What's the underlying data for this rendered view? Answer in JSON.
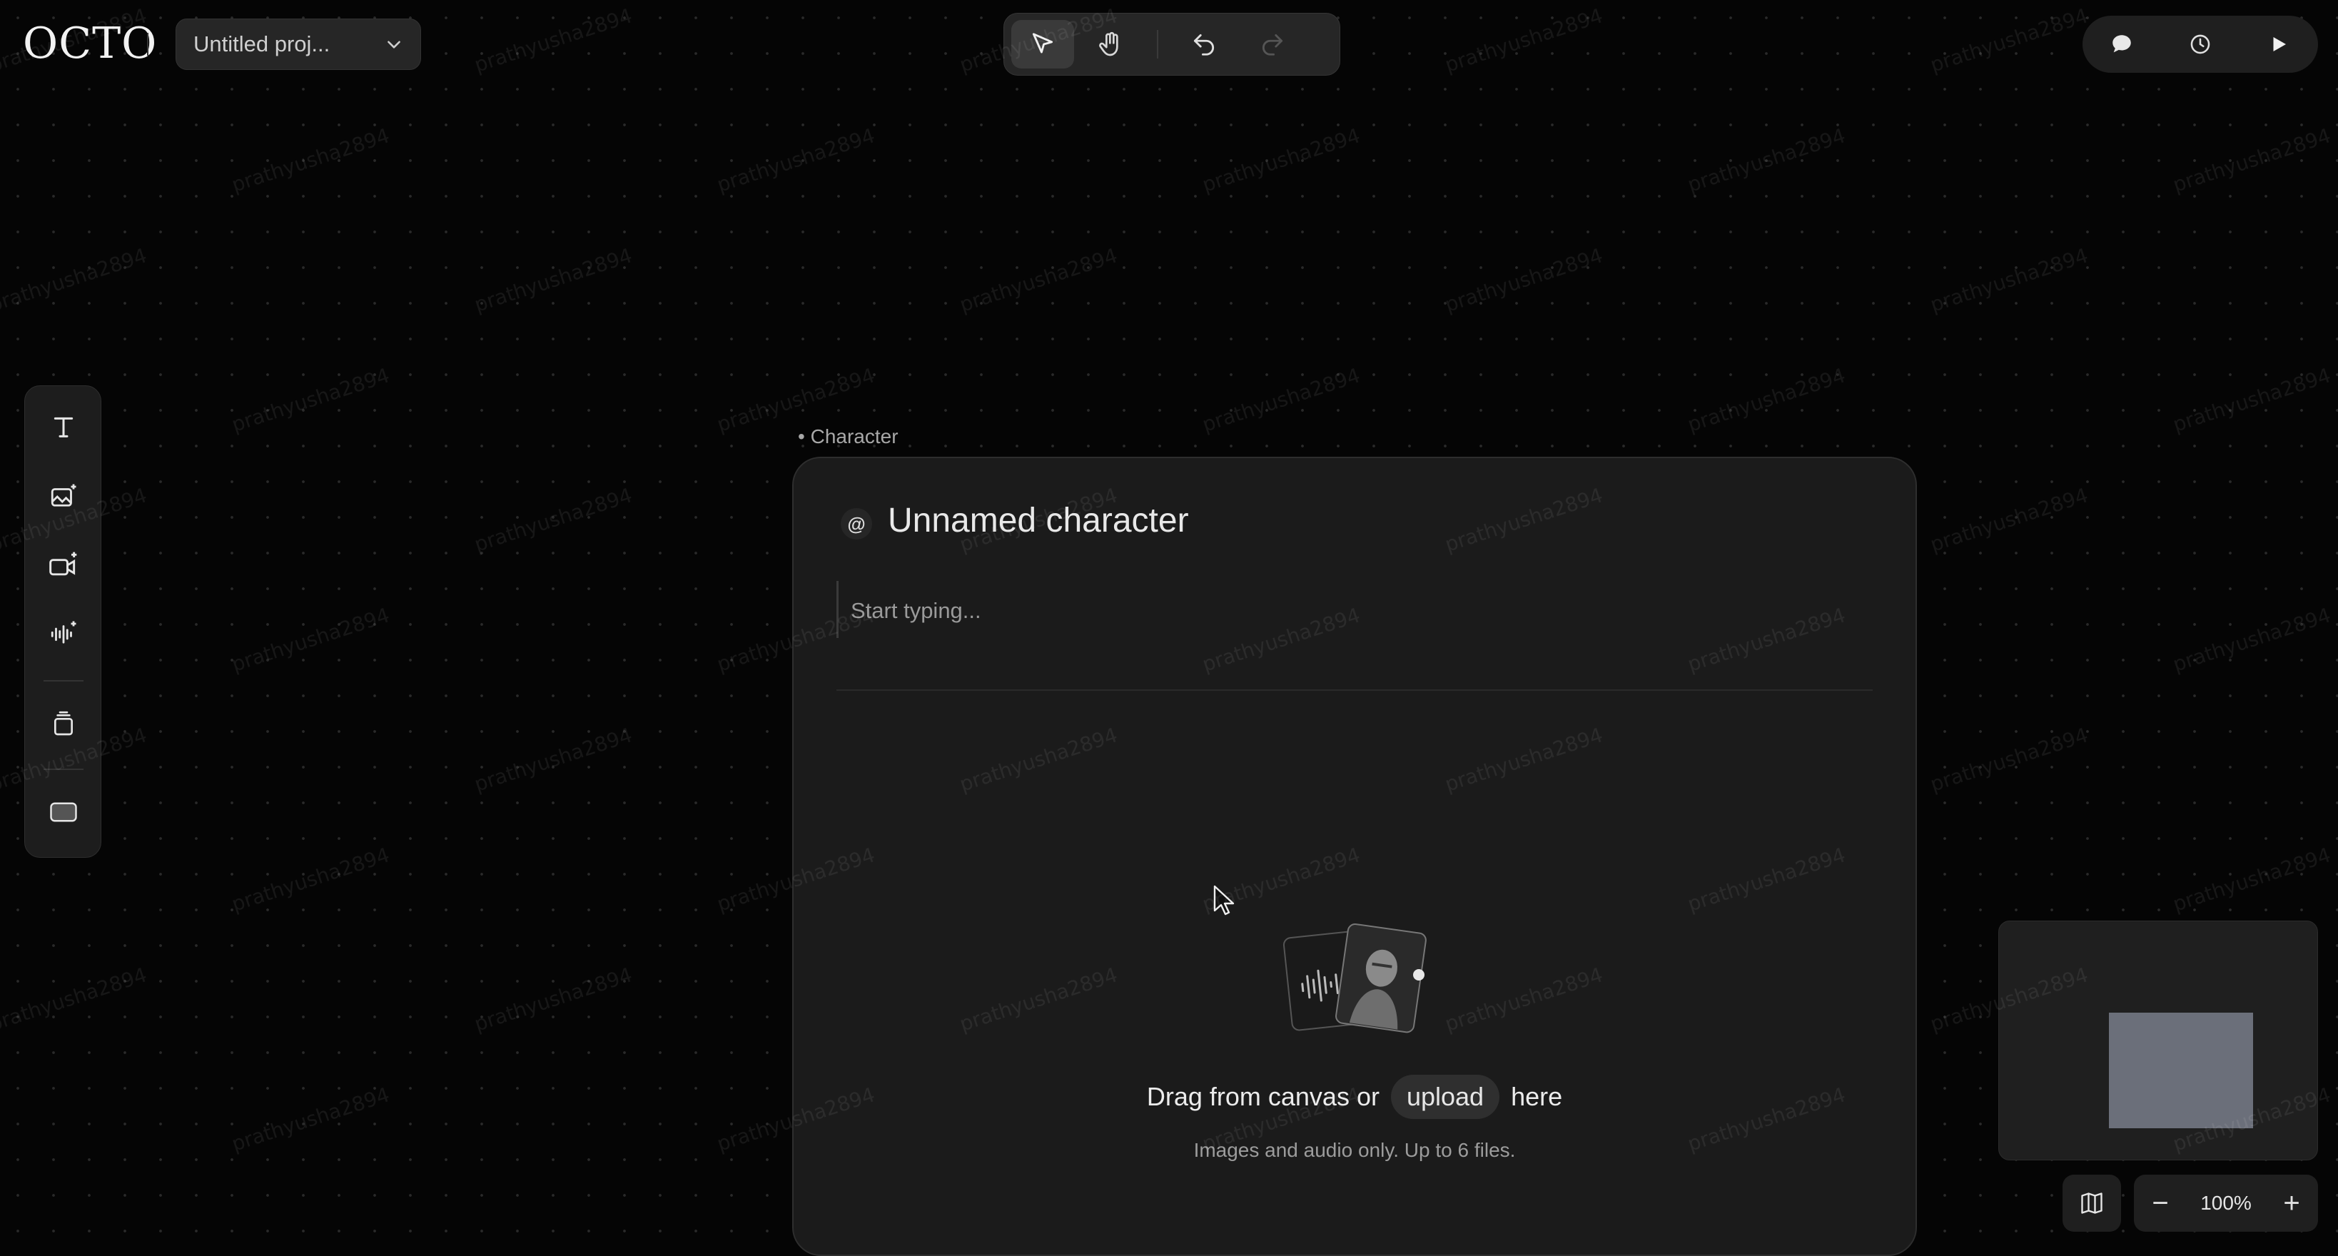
{
  "app": {
    "logo": "OCTO"
  },
  "header": {
    "project_name": "Untitled proj...",
    "project_chevron_icon": "chevron-down-icon"
  },
  "toolbar": {
    "tools": [
      {
        "name": "select",
        "icon": "pointer-icon",
        "active": true
      },
      {
        "name": "pan",
        "icon": "hand-icon",
        "active": false
      }
    ],
    "undo_icon": "undo-icon",
    "redo_icon": "redo-icon"
  },
  "right_controls": {
    "chat_icon": "chat-icon",
    "history_icon": "history-icon",
    "play_icon": "play-icon"
  },
  "left_toolbar": {
    "items": [
      "text-icon",
      "image-generate-icon",
      "video-generate-icon",
      "audio-generate-icon",
      "stack-icon",
      "frame-icon"
    ]
  },
  "card": {
    "label": "Character",
    "at_symbol": "@",
    "title": "Unnamed character",
    "description_placeholder": "Start typing...",
    "drop_text_before": "Drag from canvas or",
    "upload_label": "upload",
    "drop_text_after": "here",
    "hint": "Images and audio only. Up to 6 files."
  },
  "zoom": {
    "minus": "−",
    "value": "100%",
    "plus": "+"
  },
  "watermark": "prathyusha2894",
  "colors": {
    "background": "#050505",
    "card": "#1b1b1b",
    "minimap_view": "#6b6f7a"
  }
}
